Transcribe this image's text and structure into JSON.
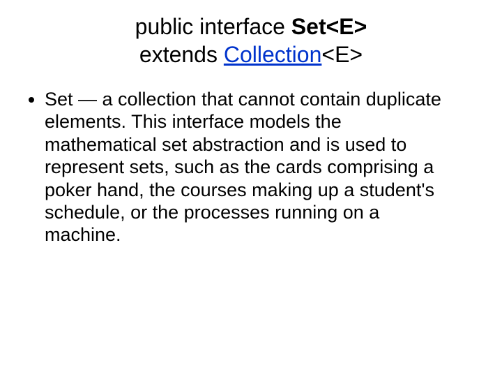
{
  "title": {
    "prefix": "public interface ",
    "bold": "Set<E>",
    "line2_prefix": "extends ",
    "link": "Collection",
    "line2_suffix": "<E>"
  },
  "bullet": {
    "text": "Set — a collection that cannot contain duplicate elements. This interface models the mathematical set abstraction and is used to represent sets, such as the cards comprising a poker hand, the courses making up a student's schedule, or the processes running on a machine."
  }
}
